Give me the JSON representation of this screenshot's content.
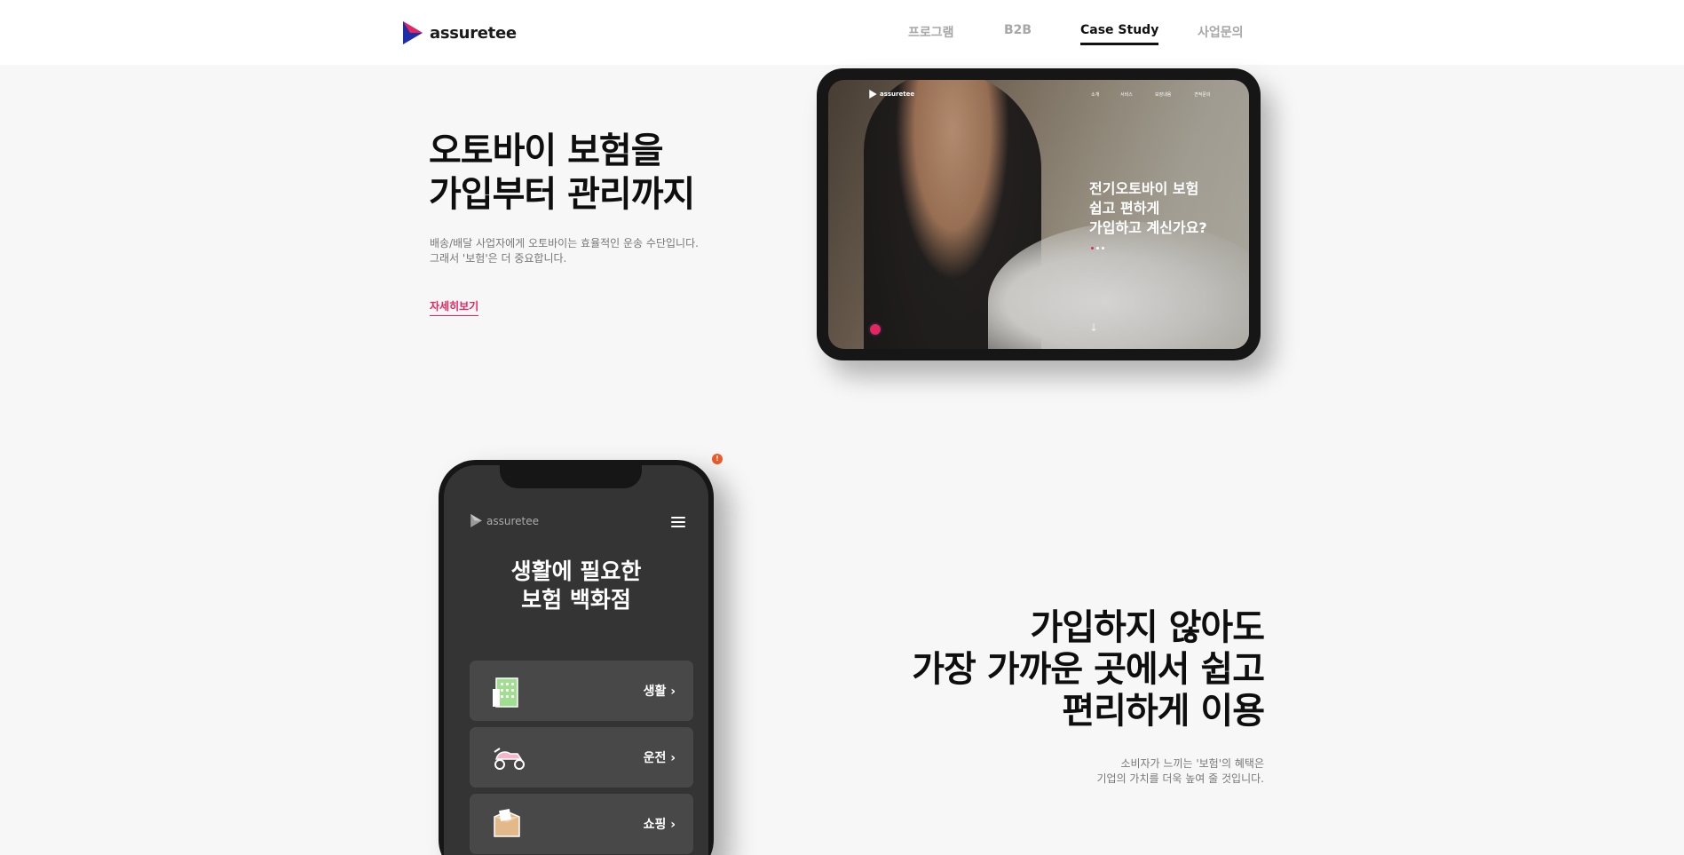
{
  "header": {
    "logo_text": "assuretee",
    "nav": [
      {
        "label": "프로그램"
      },
      {
        "label": "B2B"
      },
      {
        "label": "Case Study"
      },
      {
        "label": "사업문의"
      }
    ]
  },
  "hero": {
    "title_lines": [
      "오토바이 보험을",
      "가입부터 관리까지"
    ],
    "desc_lines": [
      "배송/배달 사업자에게 오토바이는 효율적인 운송 수단입니다.",
      "그래서 '보험'은 더 중요합니다."
    ],
    "link_label": "자세히보기"
  },
  "tablet": {
    "logo_text": "assuretee",
    "nav": [
      "소개",
      "서비스",
      "보장내용",
      "견적문의"
    ],
    "headline_lines": [
      "전기오토바이 보험",
      "쉽고 편하게",
      "가입하고 계신가요?"
    ],
    "arrow": "↓"
  },
  "notice": {
    "label": "!"
  },
  "phone": {
    "logo_text": "assuretee",
    "title_lines": [
      "생활에 필요한",
      "보험 백화점"
    ],
    "categories": [
      {
        "label": "생활",
        "icon": "building-icon"
      },
      {
        "label": "운전",
        "icon": "scooter-icon"
      },
      {
        "label": "쇼핑",
        "icon": "box-icon"
      }
    ],
    "chevron": "›"
  },
  "section2": {
    "title_lines": [
      "가입하지 않아도",
      "가장 가까운 곳에서 쉽고",
      "편리하게 이용"
    ],
    "desc_lines": [
      "소비자가 느끼는 '보험'의 혜택은",
      "기업의 가치를 더욱 높여 줄 것입니다."
    ]
  },
  "colors": {
    "accent": "#e6255f",
    "notice": "#f05a28",
    "brand_blue": "#1d2ea8"
  }
}
